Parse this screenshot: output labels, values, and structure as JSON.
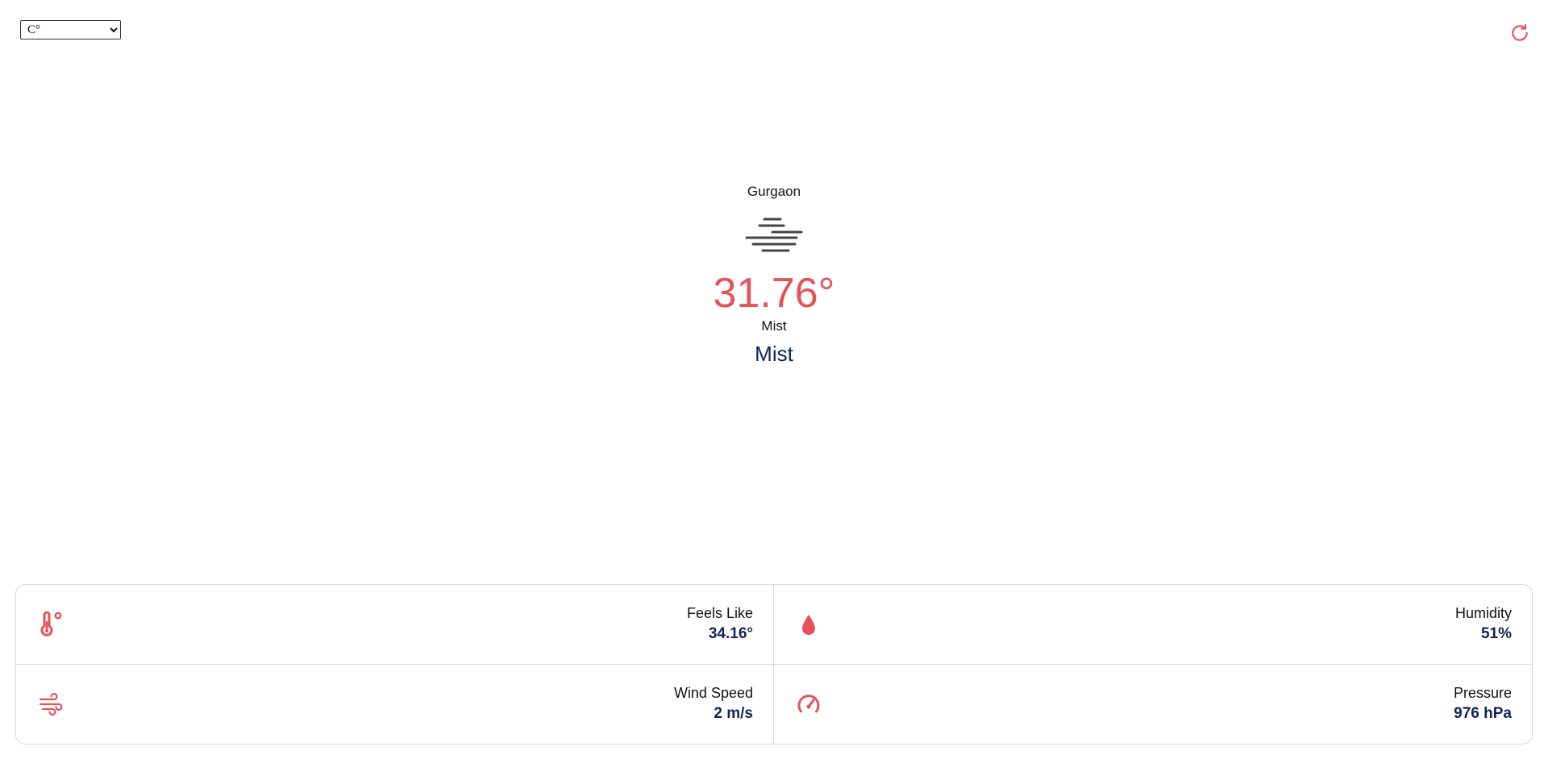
{
  "header": {
    "unit_selected": "C°",
    "unit_options": [
      "C°"
    ]
  },
  "current": {
    "city": "Gurgaon",
    "temperature": "31.76°",
    "condition": "Mist",
    "description": "Mist",
    "icon": "mist-icon"
  },
  "details": {
    "feels_like": {
      "label": "Feels Like",
      "value": "34.16°",
      "icon": "thermometer-icon"
    },
    "humidity": {
      "label": "Humidity",
      "value": "51%",
      "icon": "water-drop-icon"
    },
    "wind_speed": {
      "label": "Wind Speed",
      "value": "2 m/s",
      "icon": "wind-icon"
    },
    "pressure": {
      "label": "Pressure",
      "value": "976 hPa",
      "icon": "gauge-icon"
    }
  },
  "colors": {
    "accent": "#e5525b",
    "value_text": "#0f2557",
    "icon_gray": "#444444",
    "border": "#d8d8d8"
  }
}
